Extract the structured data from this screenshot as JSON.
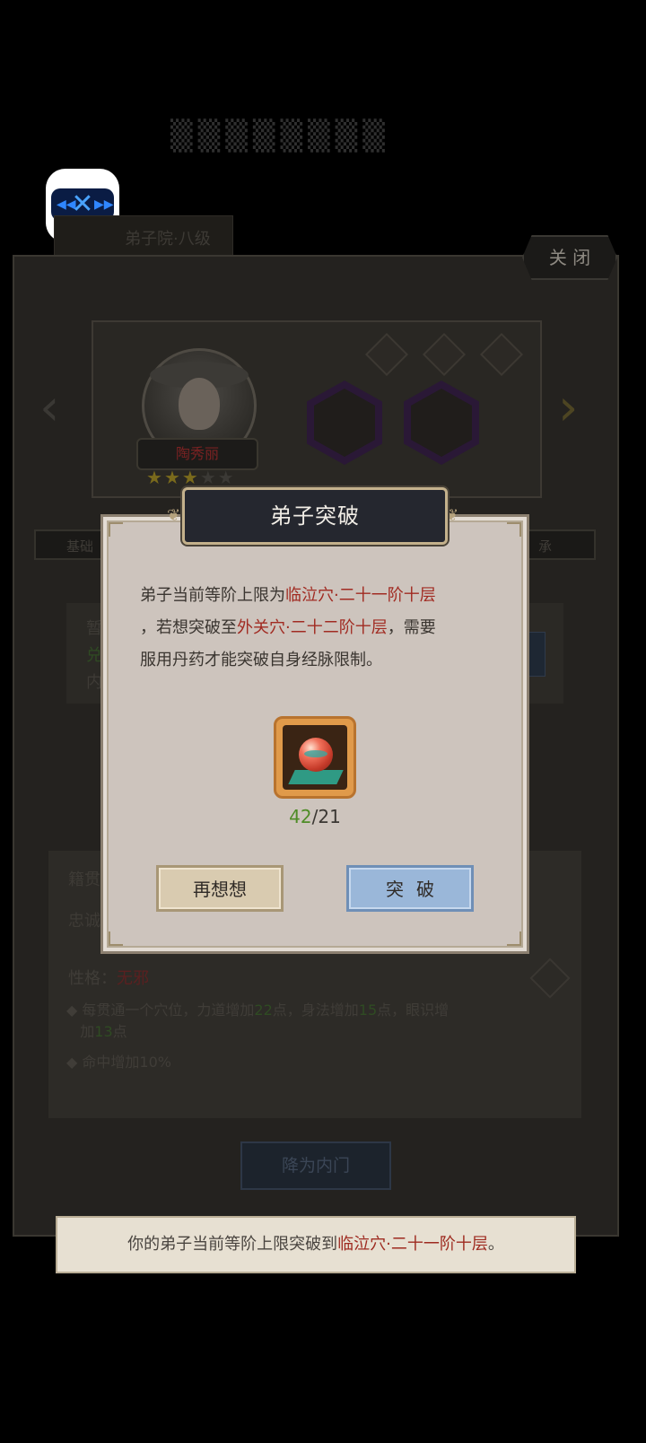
{
  "background": {
    "tab_label": "弟子院·八级",
    "close_label": "关 闭",
    "character_name": "陶秀丽",
    "stars_filled": 3,
    "stars_total": 5,
    "bar_left_label": "基础",
    "bar_right_label": "承",
    "info_chars": [
      "暂",
      "兑",
      "内"
    ],
    "detail_labels": [
      "籍贯",
      "忠诚"
    ],
    "trait_label": "性格：",
    "trait_value": "无邪",
    "bullet1_a": "每贯通一个穴位，力道增加",
    "bullet1_b": "22",
    "bullet1_c": "点，身法增加",
    "bullet1_d": "15",
    "bullet1_e": "点，眼识增",
    "bullet1_f": "加",
    "bullet1_g": "13",
    "bullet1_h": "点",
    "bullet2": "命中增加10%",
    "demote_label": "降为内门"
  },
  "modal": {
    "title": "弟子突破",
    "line1_a": "弟子当前等阶上限为",
    "line1_b": "临泣穴·二十一阶十层",
    "line2_a": "，若想突破至",
    "line2_b": "外关穴·二十二阶十层",
    "line2_c": "，需要",
    "line3": "服用丹药才能突破自身经脉限制。",
    "item_icon": "red-pill-orb-icon",
    "count_have": "42",
    "count_sep": "/",
    "count_need": "21",
    "btn_reconsider": "再想想",
    "btn_breakthrough": "突破"
  },
  "toast": {
    "text_a": "你的弟子当前等阶上限突破到",
    "text_b": "临泣穴·二十一阶十层",
    "text_c": "。"
  },
  "colors": {
    "highlight_red": "#a12b22",
    "count_green": "#4f8c27",
    "breakthrough_blue": "#9ab7d9"
  }
}
